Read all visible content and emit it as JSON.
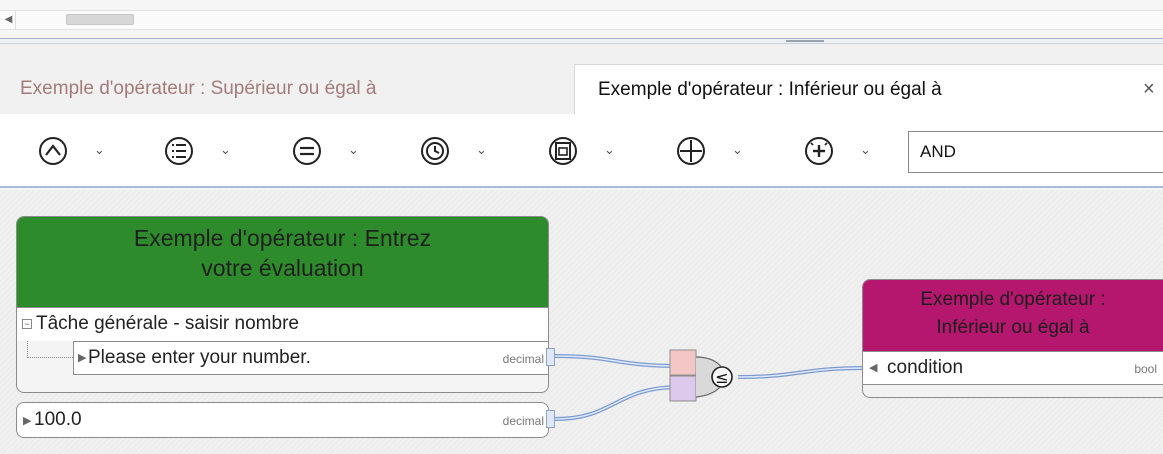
{
  "tabs": [
    {
      "label": "Exemple d'opérateur : Supérieur ou égal à",
      "active": false
    },
    {
      "label": "Exemple d'opérateur : Inférieur ou égal à",
      "active": true
    }
  ],
  "tab_close_glyph": "×",
  "toolbar": {
    "tools": [
      {
        "icon": "logic-caret-icon",
        "dropdown": "⌄"
      },
      {
        "icon": "list-icon",
        "dropdown": "⌄"
      },
      {
        "icon": "equals-icon",
        "dropdown": "⌄"
      },
      {
        "icon": "clock-icon",
        "dropdown": "⌄"
      },
      {
        "icon": "document-icon",
        "dropdown": "⌄"
      },
      {
        "icon": "plus-icon",
        "dropdown": "⌄"
      },
      {
        "icon": "plus-sparkle-icon",
        "dropdown": "⌄"
      }
    ],
    "operator_value": "AND"
  },
  "canvas": {
    "task_block": {
      "title_line1": "Exemple d'opérateur : Entrez",
      "title_line2": "votre évaluation",
      "task_label": "Tâche générale - saisir nombre",
      "field_label": "Please enter your number.",
      "field_type": "decimal",
      "header_color": "#2e8b2b"
    },
    "constant": {
      "value": "100.0",
      "type": "decimal"
    },
    "operator": {
      "symbol": "≤",
      "name": "less-or-equal-operator"
    },
    "result_block": {
      "title_line1": "Exemple d'opérateur :",
      "title_line2": "Inférieur ou égal à",
      "input_label": "condition",
      "input_type": "bool",
      "header_color": "#b5166e"
    }
  }
}
